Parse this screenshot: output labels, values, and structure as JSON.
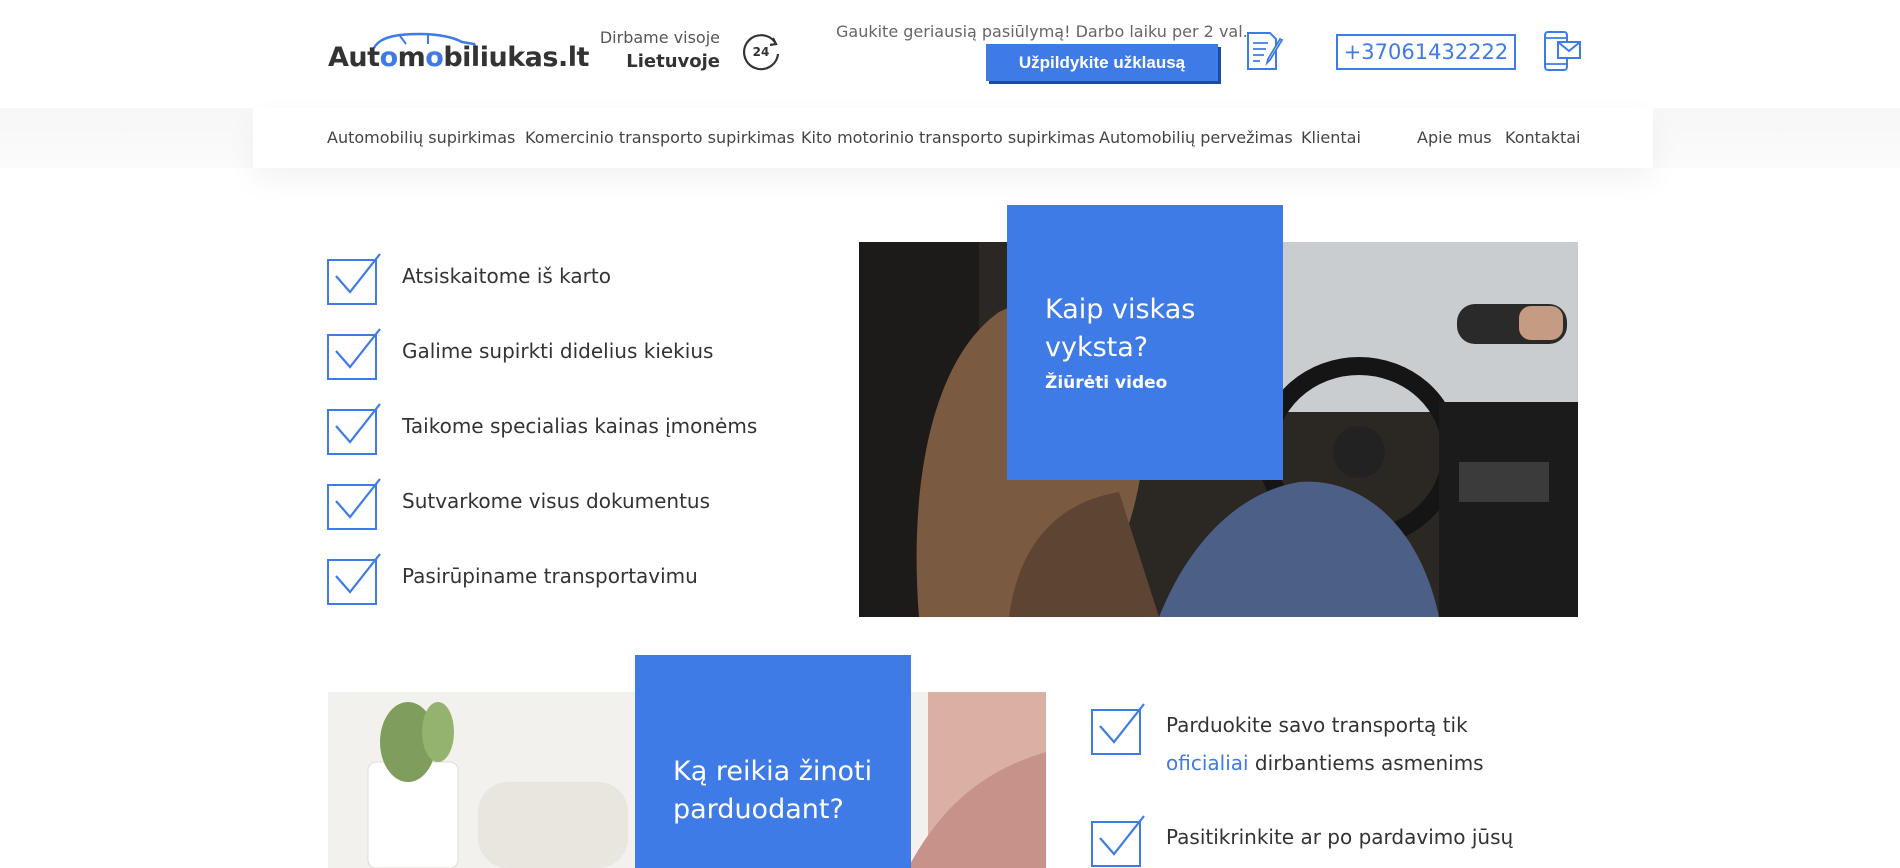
{
  "header": {
    "logo_text": "Automobiliukas.lt",
    "work_line1": "Dirbame visoje",
    "work_line2": "Lietuvoje",
    "offer_text": "Gaukite geriausią pasiūlymą! Darbo laiku per 2 val.",
    "cta_label": "Užpildykite užklausą",
    "phone": "+37061432222"
  },
  "nav": {
    "items": [
      "Automobilių supirkimas",
      "Komercinio transporto supirkimas",
      "Kito motorinio transporto supirkimas",
      "Automobilių pervežimas",
      "Klientai",
      "Apie mus",
      "Kontaktai"
    ]
  },
  "features": [
    "Atsiskaitome iš karto",
    "Galime supirkti didelius kiekius",
    "Taikome specialias kainas įmonėms",
    "Sutvarkome visus dokumentus",
    "Pasirūpiname transportavimu"
  ],
  "video_block": {
    "title": "Kaip viskas vyksta?",
    "link": "Žiūrėti video"
  },
  "know_block": {
    "title": "Ką reikia žinoti parduodant?"
  },
  "tips": [
    {
      "before": "Parduokite savo transportą tik ",
      "accent": "oficialiai",
      "after": " dirbantiems asmenims"
    },
    {
      "before": "Pasitikrinkite ar po pardavimo jūsų",
      "accent": "",
      "after": ""
    }
  ],
  "colors": {
    "accent": "#3e7be6",
    "text": "#333333"
  }
}
